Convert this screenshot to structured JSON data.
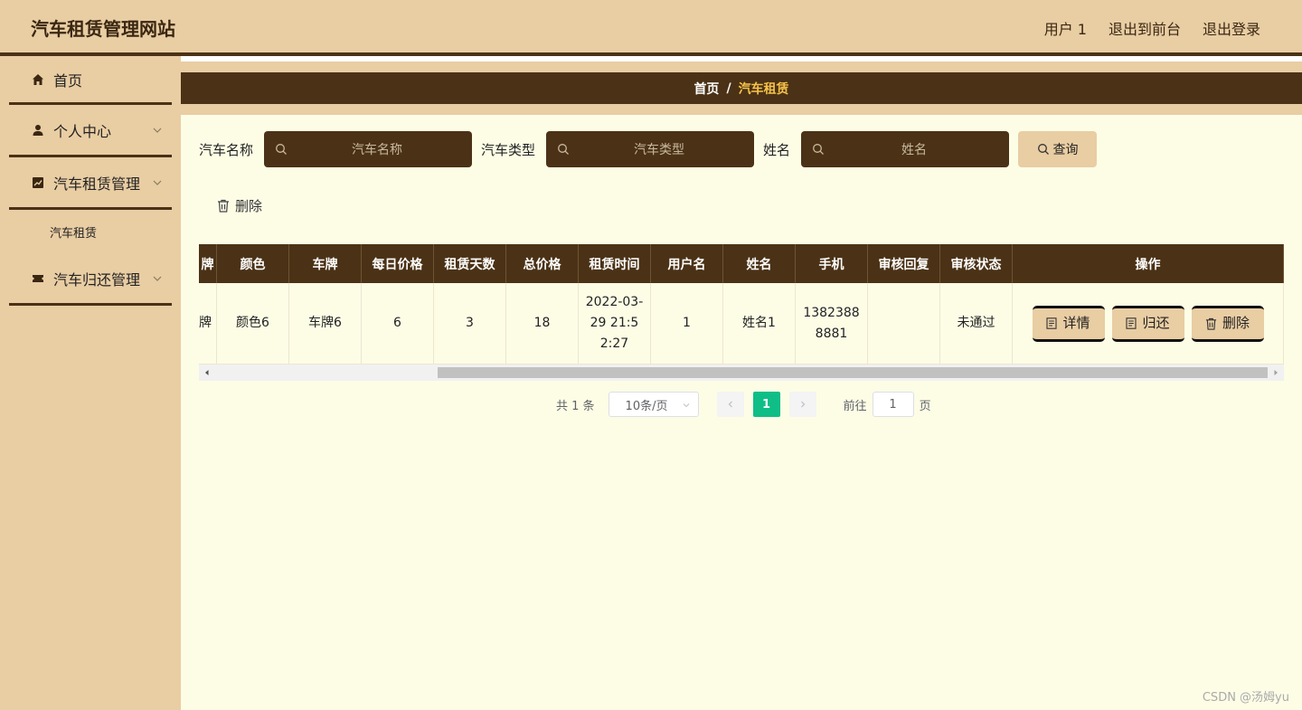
{
  "header": {
    "title": "汽车租赁管理网站",
    "user": "用户 1",
    "to_front": "退出到前台",
    "logout": "退出登录"
  },
  "sidebar": {
    "items": [
      {
        "label": "首页",
        "icon": "home-icon"
      },
      {
        "label": "个人中心",
        "icon": "user-icon"
      },
      {
        "label": "汽车租赁管理",
        "icon": "chart-icon"
      },
      {
        "label": "汽车租赁",
        "icon": ""
      },
      {
        "label": "汽车归还管理",
        "icon": "ticket-icon"
      }
    ]
  },
  "breadcrumb": {
    "home": "首页",
    "sep": "/",
    "current": "汽车租赁"
  },
  "search": {
    "car_name_label": "汽车名称",
    "car_name_placeholder": "汽车名称",
    "car_type_label": "汽车类型",
    "car_type_placeholder": "汽车类型",
    "name_label": "姓名",
    "name_placeholder": "姓名",
    "query_button": "查询"
  },
  "toolbar": {
    "delete_label": "删除"
  },
  "table": {
    "headers": [
      "牌",
      "颜色",
      "车牌",
      "每日价格",
      "租赁天数",
      "总价格",
      "租赁时间",
      "用户名",
      "姓名",
      "手机",
      "审核回复",
      "审核状态",
      "操作"
    ],
    "rows": [
      {
        "cells": [
          "牌",
          "颜色6",
          "车牌6",
          "6",
          "3",
          "18",
          "2022-03-29 21:52:27",
          "1",
          "姓名1",
          "13823888881",
          "",
          "未通过"
        ],
        "actions": {
          "detail": "详情",
          "return": "归还",
          "delete": "删除"
        }
      }
    ]
  },
  "pagination": {
    "total": "共 1 条",
    "page_size": "10条/页",
    "current_page": "1",
    "goto_label": "前往",
    "goto_value": "1",
    "page_suffix": "页"
  },
  "watermark": "CSDN @汤姆yu",
  "colors": {
    "brand_dark": "#4b3216",
    "brand_light": "#e9cda3",
    "background": "#fdfde6",
    "accent_gold": "#f5c24a",
    "page_active": "#0fbe87"
  }
}
